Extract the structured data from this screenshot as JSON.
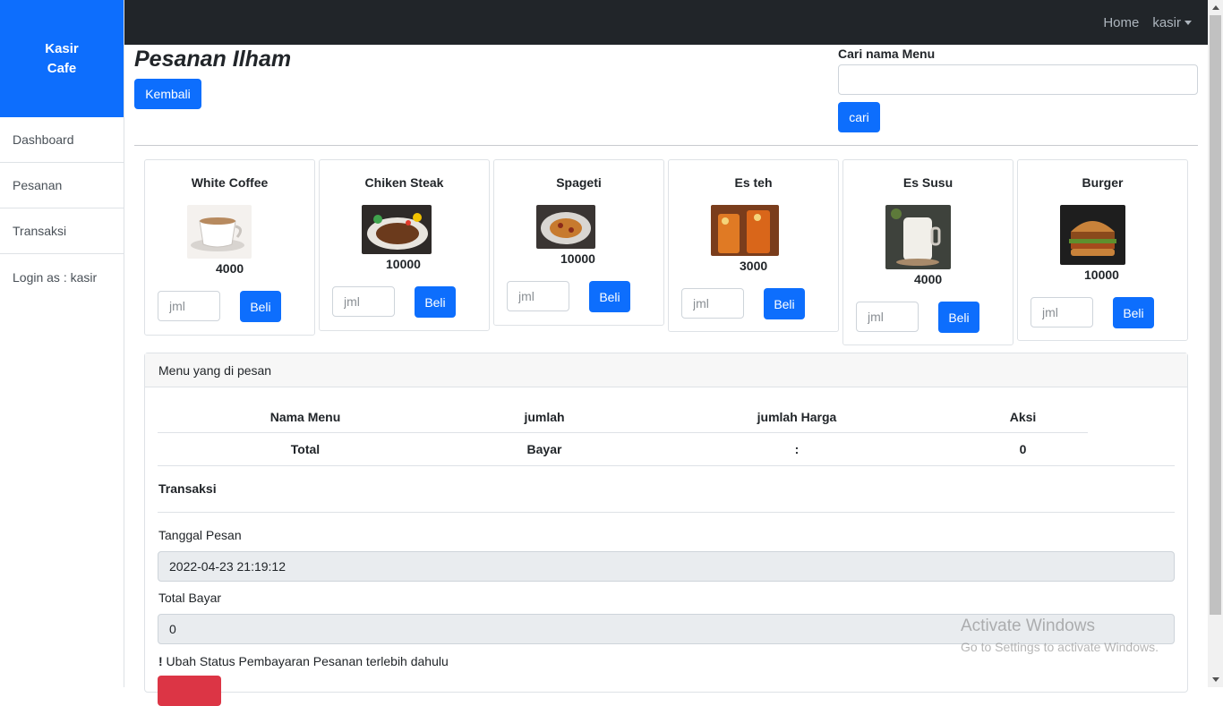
{
  "sidebar": {
    "brand_line1": "Kasir",
    "brand_line2": "Cafe",
    "items": [
      {
        "label": "Dashboard"
      },
      {
        "label": "Pesanan"
      },
      {
        "label": "Transaksi"
      },
      {
        "label": "Login as : kasir"
      }
    ]
  },
  "topbar": {
    "home": "Home",
    "user": "kasir"
  },
  "header": {
    "title": "Pesanan Ilham",
    "back_label": "Kembali"
  },
  "search": {
    "label": "Cari nama Menu",
    "value": "",
    "button": "cari"
  },
  "menu": [
    {
      "name": "White Coffee",
      "price": "4000",
      "placeholder": "jml",
      "buy": "Beli",
      "img_color": "#e9e3dc"
    },
    {
      "name": "Chiken Steak",
      "price": "10000",
      "placeholder": "jml",
      "buy": "Beli",
      "img_color": "#5a3b22"
    },
    {
      "name": "Spageti",
      "price": "10000",
      "placeholder": "jml",
      "buy": "Beli",
      "img_color": "#7a4a2e"
    },
    {
      "name": "Es teh",
      "price": "3000",
      "placeholder": "jml",
      "buy": "Beli",
      "img_color": "#c9641f"
    },
    {
      "name": "Es Susu",
      "price": "4000",
      "placeholder": "jml",
      "buy": "Beli",
      "img_color": "#3b3f3a"
    },
    {
      "name": "Burger",
      "price": "10000",
      "placeholder": "jml",
      "buy": "Beli",
      "img_color": "#6b3a17"
    }
  ],
  "order": {
    "panel_title": "Menu yang di pesan",
    "headers": [
      "Nama Menu",
      "jumlah",
      "jumlah Harga",
      "Aksi"
    ],
    "total_row": [
      "Total",
      "Bayar",
      ":",
      "0"
    ],
    "transaction_title": "Transaksi",
    "date_label": "Tanggal Pesan",
    "date_value": "2022-04-23 21:19:12",
    "total_label": "Total Bayar",
    "total_value": "0",
    "warning_mark": "!",
    "warning_text": " Ubah Status Pembayaran Pesanan terlebih dahulu",
    "action_label": ""
  },
  "watermark": {
    "line1": "Activate Windows",
    "line2": "Go to Settings to activate Windows."
  },
  "colors": {
    "primary": "#0d6efd",
    "dark": "#212529",
    "danger": "#dc3545"
  }
}
